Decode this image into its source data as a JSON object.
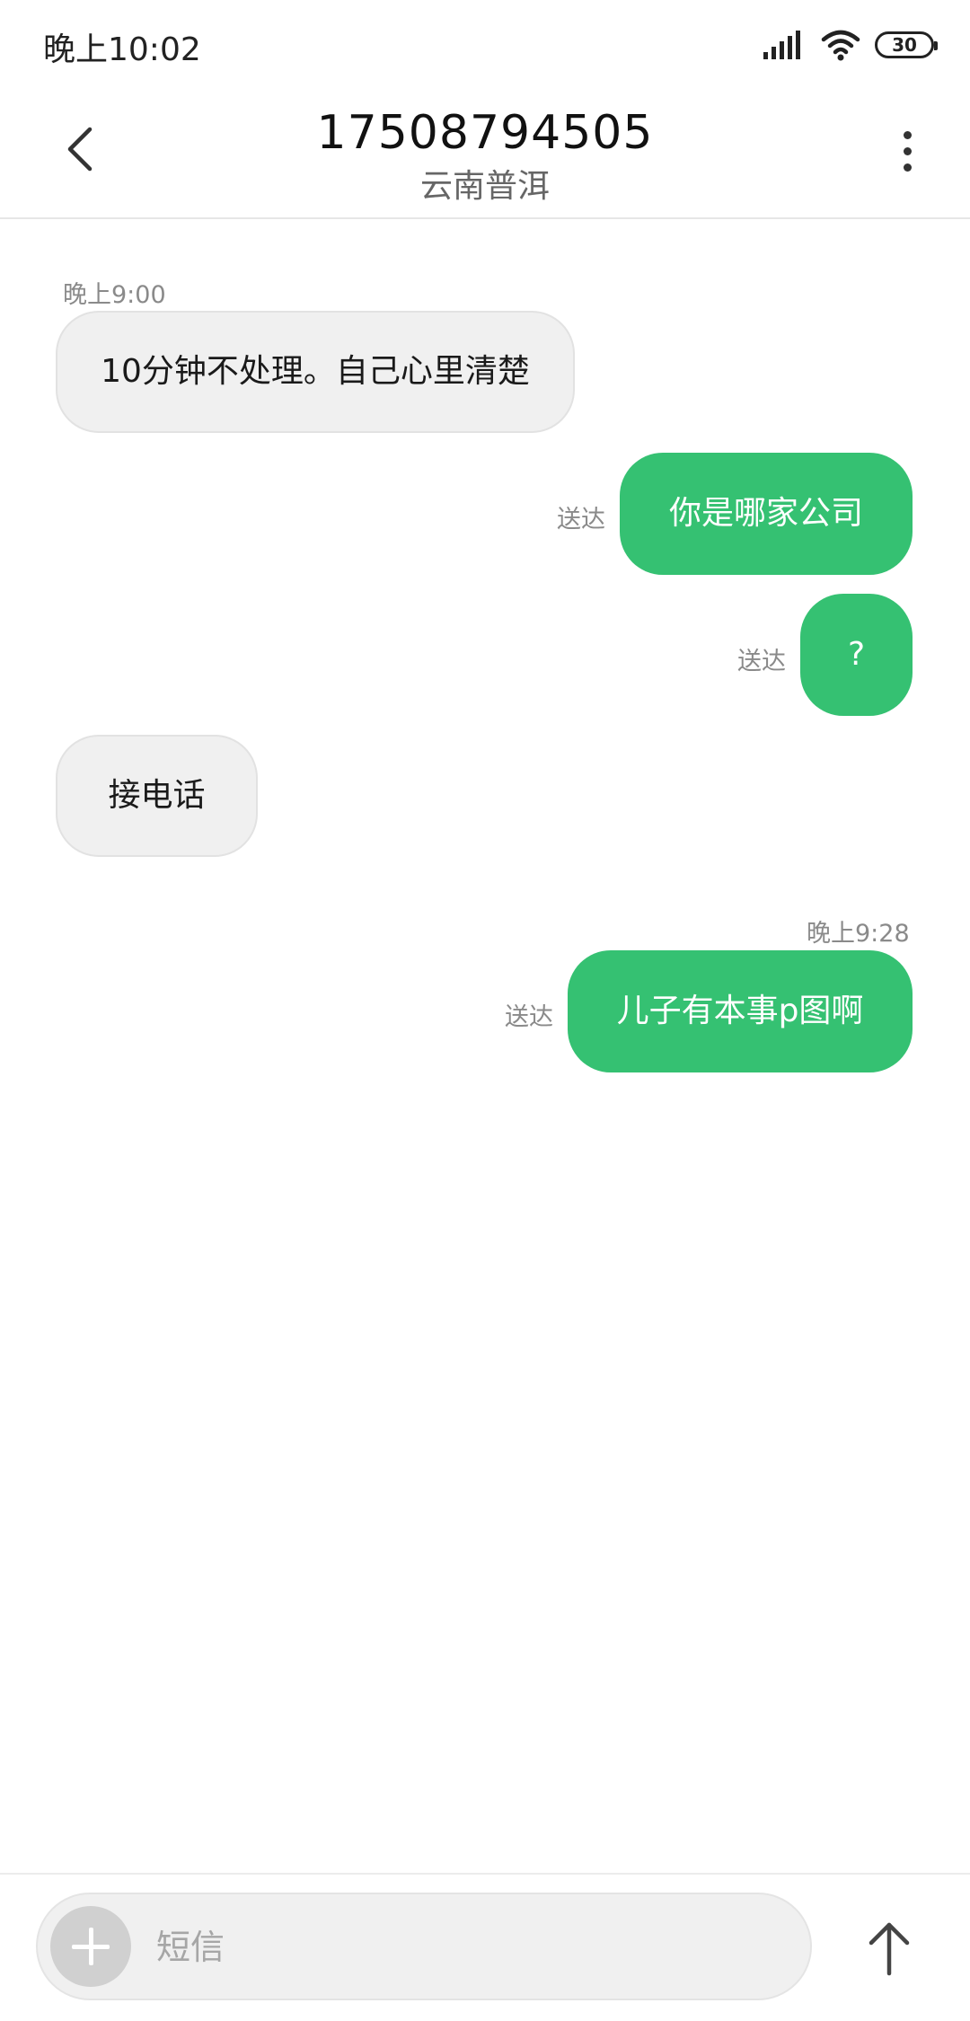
{
  "status_bar": {
    "time": "晚上10:02",
    "battery": "30",
    "icons": [
      "signal-icon",
      "wifi-icon",
      "battery-icon"
    ]
  },
  "header": {
    "title": "17508794505",
    "subtitle": "云南普洱",
    "back_icon": "chevron-left-icon",
    "more_icon": "more-vertical-icon"
  },
  "messages": [
    {
      "direction": "in",
      "timestamp": "晚上9:00",
      "text": "10分钟不处理。自己心里清楚"
    },
    {
      "direction": "out",
      "text": "你是哪家公司",
      "status": "送达"
    },
    {
      "direction": "out",
      "text": "?",
      "status": "送达"
    },
    {
      "direction": "in",
      "text": "接电话"
    },
    {
      "direction": "out",
      "timestamp": "晚上9:28",
      "text": "儿子有本事p图啊",
      "status": "送达"
    }
  ],
  "composer": {
    "placeholder": "短信",
    "value": "",
    "add_icon": "plus-icon",
    "send_icon": "arrow-up-icon"
  },
  "colors": {
    "outgoing_bubble": "#35c172",
    "incoming_bubble": "#f0f0f0",
    "meta_text": "#8a8a8a"
  }
}
